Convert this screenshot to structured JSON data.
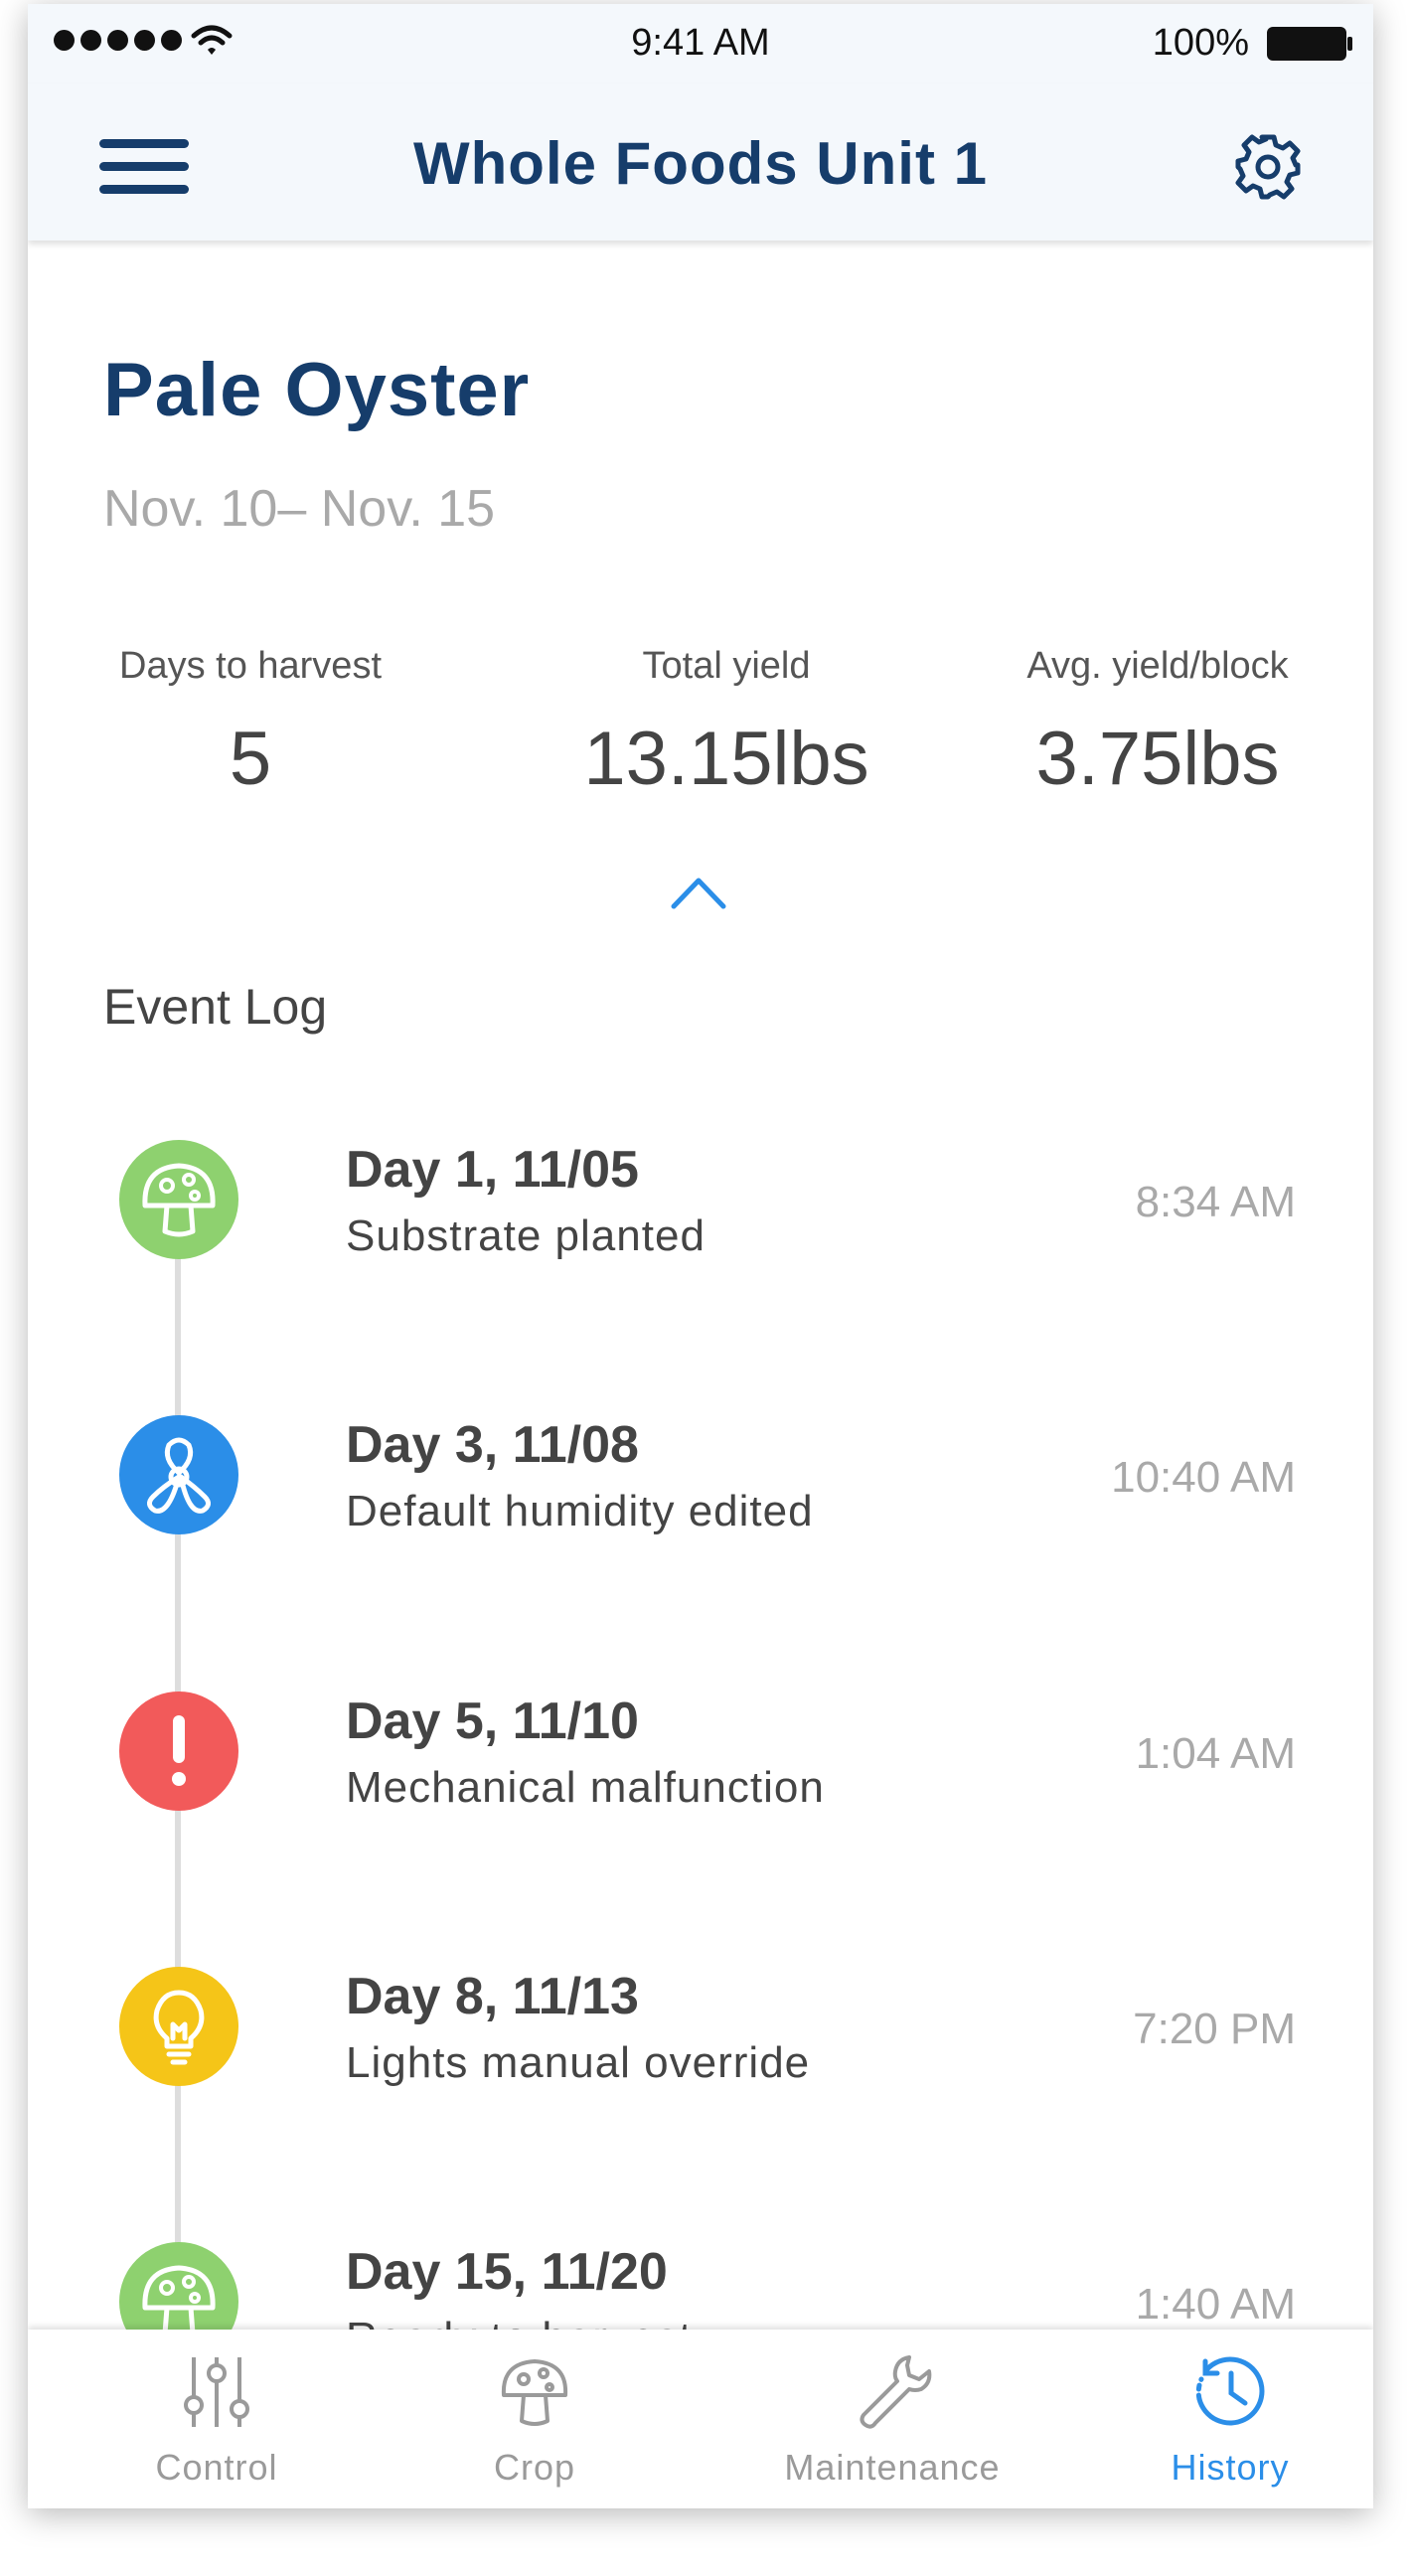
{
  "status_bar": {
    "time": "9:41 AM",
    "battery": "100%"
  },
  "header": {
    "title": "Whole Foods Unit 1",
    "menu_icon": "hamburger-menu-icon",
    "settings_icon": "gear-icon"
  },
  "crop": {
    "name": "Pale Oyster",
    "dates": "Nov. 10– Nov. 15",
    "stats": [
      {
        "label": "Days to harvest",
        "value": "5"
      },
      {
        "label": "Total yield",
        "value": "13.15lbs"
      },
      {
        "label": "Avg. yield/block",
        "value": "3.75lbs"
      }
    ]
  },
  "event_log": {
    "title": "Event Log",
    "events": [
      {
        "day": "Day 1, 11/05",
        "description": "Substrate planted",
        "time": "8:34 AM",
        "icon": "mushroom-icon",
        "color": "#8ed16f"
      },
      {
        "day": "Day 3, 11/08",
        "description": "Default humidity edited",
        "time": "10:40 AM",
        "icon": "fan-icon",
        "color": "#2b8ee8"
      },
      {
        "day": "Day 5, 11/10",
        "description": "Mechanical malfunction",
        "time": "1:04 AM",
        "icon": "alert-icon",
        "color": "#f25a5a"
      },
      {
        "day": "Day 8, 11/13",
        "description": "Lights manual override",
        "time": "7:20 PM",
        "icon": "lightbulb-icon",
        "color": "#f5c518"
      },
      {
        "day": "Day 15, 11/20",
        "description": "Ready to harvest",
        "time": "1:40 AM",
        "icon": "mushroom-icon",
        "color": "#8ed16f"
      }
    ]
  },
  "tab_bar": {
    "tabs": [
      {
        "label": "Control",
        "icon": "sliders-icon"
      },
      {
        "label": "Crop",
        "icon": "mushroom-icon"
      },
      {
        "label": "Maintenance",
        "icon": "wrench-icon"
      },
      {
        "label": "History",
        "icon": "history-clock-icon",
        "active": true
      }
    ]
  },
  "colors": {
    "primary": "#163d6b",
    "accent": "#2b8ee8",
    "muted": "#a9a9a9"
  }
}
